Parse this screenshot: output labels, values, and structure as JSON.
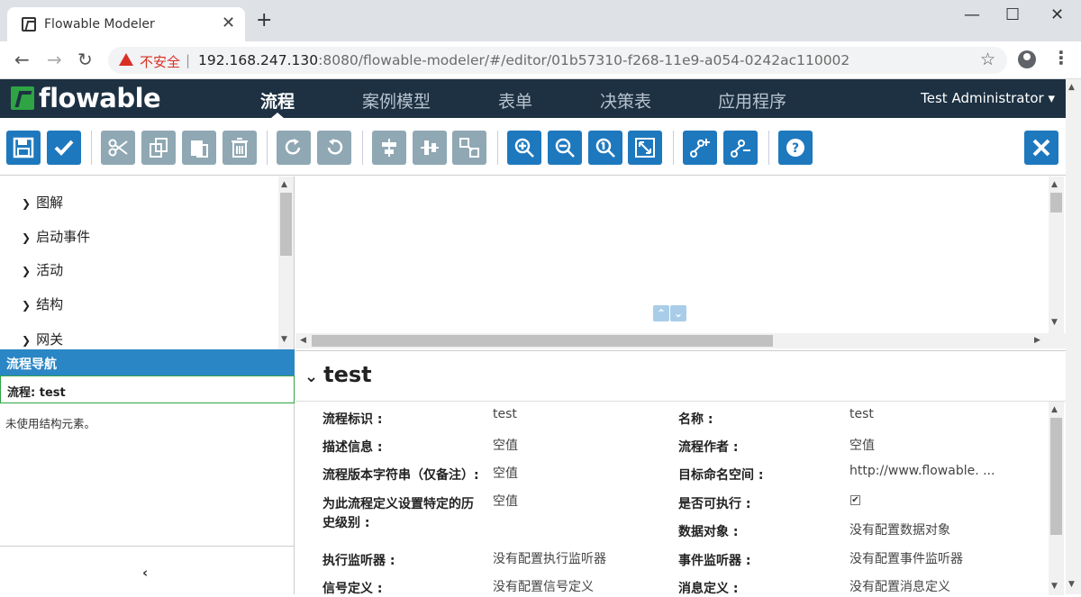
{
  "browser": {
    "tab_title": "Flowable Modeler",
    "tab_close": "✕",
    "new_tab": "+",
    "security_label": "不安全",
    "separator": "|",
    "url_host": "192.168.247.130",
    "url_rest": ":8080/flowable-modeler/#/editor/01b57310-f268-11e9-a054-0242ac110002",
    "star": "☆",
    "kebab": "⋮",
    "window_controls": {
      "minimize": "—",
      "maximize": "☐",
      "close": "✕"
    },
    "nav": {
      "back": "←",
      "forward": "→",
      "reload": "↻"
    }
  },
  "app": {
    "logo_text": "flowable",
    "nav_items": [
      {
        "label": "流程",
        "active": true
      },
      {
        "label": "案例模型"
      },
      {
        "label": "表单"
      },
      {
        "label": "决策表"
      },
      {
        "label": "应用程序"
      }
    ],
    "user": "Test Administrator ▾"
  },
  "toolbar": {
    "buttons": [
      "save",
      "validate",
      "cut",
      "copy",
      "paste",
      "delete",
      "redo",
      "undo",
      "align-horizontal",
      "align-vertical",
      "same-size",
      "zoom-in",
      "zoom-out",
      "zoom-actual",
      "zoom-fit",
      "bend-add",
      "bend-remove",
      "help",
      "close"
    ]
  },
  "palette": {
    "items": [
      "图解",
      "启动事件",
      "活动",
      "结构",
      "网关"
    ]
  },
  "navigator": {
    "header": "流程导航",
    "selected": "流程: test",
    "empty_text": "未使用结构元素。",
    "collapse": "‹"
  },
  "properties": {
    "title": "test",
    "fields": [
      {
        "label": "流程标识 :",
        "value": "test"
      },
      {
        "label": "名称 :",
        "value": "test"
      },
      {
        "label": "描述信息 :",
        "value": "空值"
      },
      {
        "label": "流程作者 :",
        "value": "空值"
      },
      {
        "label": "流程版本字符串（仅备注）:",
        "value": "空值"
      },
      {
        "label": "目标命名空间 :",
        "value": "http://www.flowable. ..."
      },
      {
        "label": "为此流程定义设置特定的历",
        "label2": "史级别 :",
        "value": "空值"
      },
      {
        "label": "是否可执行 :",
        "value": "✔"
      },
      {
        "label": "数据对象 :",
        "value": "没有配置数据对象"
      },
      {
        "label": "执行监听器 :",
        "value": "没有配置执行监听器"
      },
      {
        "label": "事件监听器 :",
        "value": "没有配置事件监听器"
      },
      {
        "label": "信号定义 :",
        "value": "没有配置信号定义"
      },
      {
        "label": "消息定义 :",
        "value": "没有配置消息定义"
      }
    ]
  },
  "colors": {
    "nav_bg": "#1d3142",
    "primary_blue": "#1e78be",
    "disabled_gray": "#8fa8b3",
    "brand_green": "#2ea444",
    "panel_header": "#2b86c5"
  }
}
